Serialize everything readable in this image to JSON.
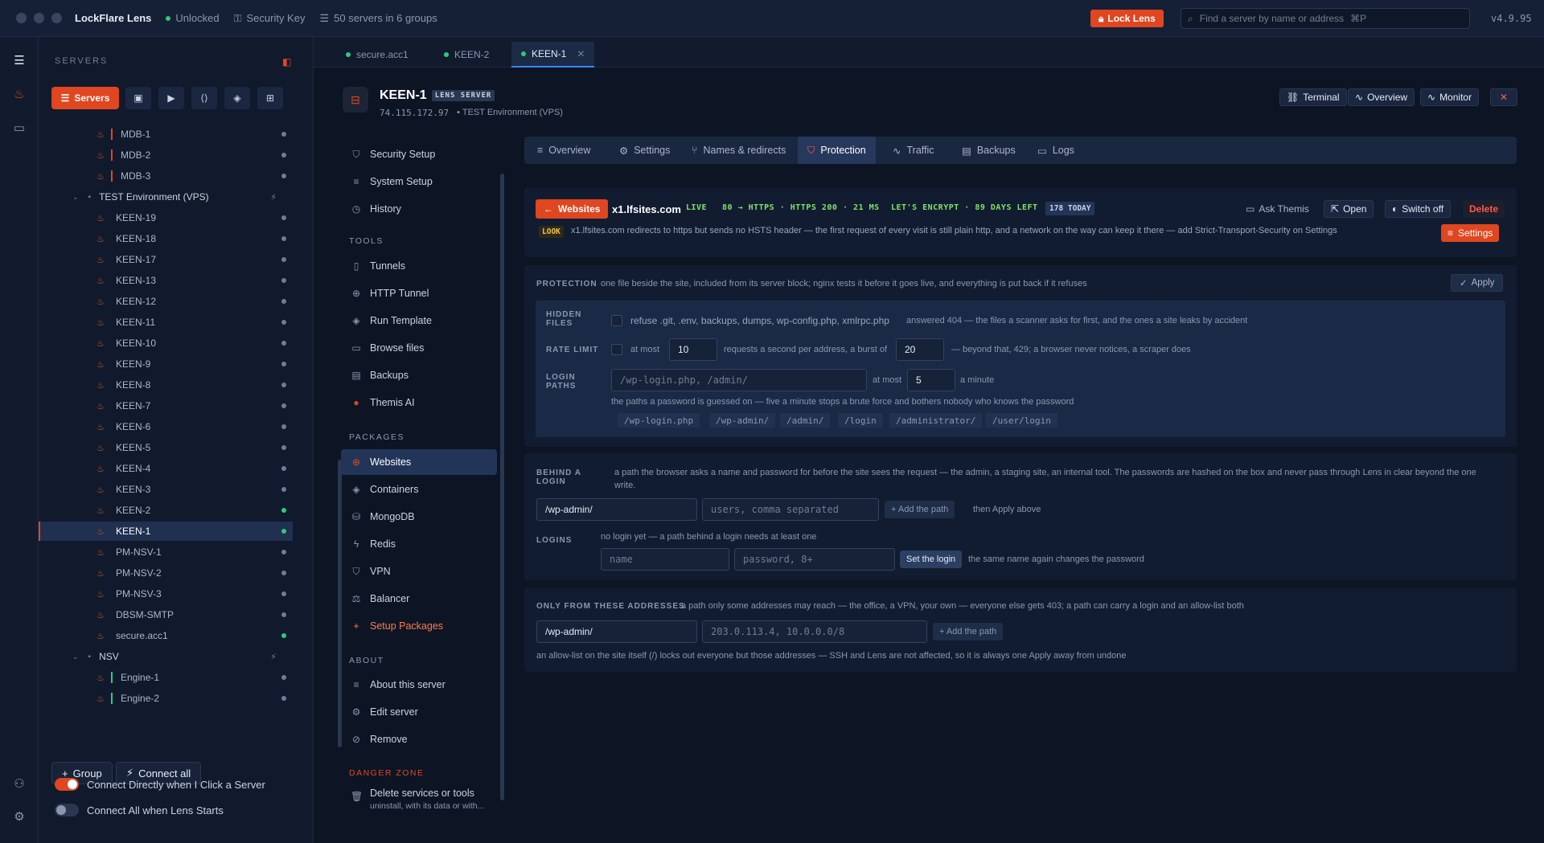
{
  "titlebar": {
    "app_name": "LockFlare Lens",
    "status": "Unlocked",
    "security_key": "Security Key",
    "servers_summary": "50 servers in 6 groups",
    "lock_button": "Lock Lens",
    "search_placeholder": "Find a server by name or address",
    "search_shortcut": "⌘P",
    "version": "v4.9.95"
  },
  "sidebar": {
    "heading": "SERVERS",
    "filter_active": "Servers",
    "tree": [
      {
        "type": "server",
        "name": "MDB-1",
        "status": "idle",
        "bar": "#e0461f"
      },
      {
        "type": "server",
        "name": "MDB-2",
        "status": "idle",
        "bar": "#e0461f"
      },
      {
        "type": "server",
        "name": "MDB-3",
        "status": "idle",
        "bar": "#e0461f"
      },
      {
        "type": "group",
        "name": "TEST Environment (VPS)"
      },
      {
        "type": "server",
        "name": "KEEN-19",
        "status": "idle"
      },
      {
        "type": "server",
        "name": "KEEN-18",
        "status": "idle"
      },
      {
        "type": "server",
        "name": "KEEN-17",
        "status": "idle"
      },
      {
        "type": "server",
        "name": "KEEN-13",
        "status": "idle"
      },
      {
        "type": "server",
        "name": "KEEN-12",
        "status": "idle"
      },
      {
        "type": "server",
        "name": "KEEN-11",
        "status": "idle"
      },
      {
        "type": "server",
        "name": "KEEN-10",
        "status": "idle"
      },
      {
        "type": "server",
        "name": "KEEN-9",
        "status": "idle"
      },
      {
        "type": "server",
        "name": "KEEN-8",
        "status": "idle"
      },
      {
        "type": "server",
        "name": "KEEN-7",
        "status": "idle"
      },
      {
        "type": "server",
        "name": "KEEN-6",
        "status": "idle"
      },
      {
        "type": "server",
        "name": "KEEN-5",
        "status": "idle"
      },
      {
        "type": "server",
        "name": "KEEN-4",
        "status": "idle"
      },
      {
        "type": "server",
        "name": "KEEN-3",
        "status": "idle"
      },
      {
        "type": "server",
        "name": "KEEN-2",
        "status": "online"
      },
      {
        "type": "server",
        "name": "KEEN-1",
        "status": "online",
        "selected": true
      },
      {
        "type": "server",
        "name": "PM-NSV-1",
        "status": "idle"
      },
      {
        "type": "server",
        "name": "PM-NSV-2",
        "status": "idle"
      },
      {
        "type": "server",
        "name": "PM-NSV-3",
        "status": "idle"
      },
      {
        "type": "server",
        "name": "DBSM-SMTP",
        "status": "idle"
      },
      {
        "type": "server",
        "name": "secure.acc1",
        "status": "online"
      },
      {
        "type": "group",
        "name": "NSV"
      },
      {
        "type": "server",
        "name": "Engine-1",
        "status": "idle",
        "bar": "#34c77b"
      },
      {
        "type": "server",
        "name": "Engine-2",
        "status": "idle",
        "bar": "#34c77b"
      }
    ],
    "group_button": "Group",
    "connect_all_button": "Connect all",
    "toggle_connect_directly": "Connect Directly when I Click a Server",
    "toggle_connect_all": "Connect All when Lens Starts",
    "toggle_connect_directly_on": true,
    "toggle_connect_all_on": false
  },
  "tabs": [
    {
      "label": "secure.acc1"
    },
    {
      "label": "KEEN-2"
    },
    {
      "label": "KEEN-1",
      "active": true
    }
  ],
  "server": {
    "name": "KEEN-1",
    "badge": "LENS SERVER",
    "address": "74.115.172.97",
    "group": "TEST Environment (VPS)",
    "btn_terminal": "Terminal",
    "btn_overview": "Overview",
    "btn_monitor": "Monitor"
  },
  "menu": {
    "security_setup": "Security Setup",
    "system_setup": "System Setup",
    "history": "History",
    "tools_heading": "TOOLS",
    "tunnels": "Tunnels",
    "http_tunnel": "HTTP Tunnel",
    "run_template": "Run Template",
    "browse_files": "Browse files",
    "backups": "Backups",
    "themis_ai": "Themis AI",
    "packages_heading": "PACKAGES",
    "websites": "Websites",
    "containers": "Containers",
    "mongodb": "MongoDB",
    "redis": "Redis",
    "vpn": "VPN",
    "balancer": "Balancer",
    "setup_packages": "Setup Packages",
    "about_heading": "ABOUT",
    "about_server": "About this server",
    "edit_server": "Edit server",
    "remove": "Remove",
    "danger_heading": "DANGER ZONE",
    "delete_services": "Delete services or tools",
    "delete_services_sub": "uninstall, with its data or with..."
  },
  "content_tabs": {
    "overview": "Overview",
    "settings": "Settings",
    "names": "Names & redirects",
    "protection": "Protection",
    "traffic": "Traffic",
    "backups": "Backups",
    "logs": "Logs"
  },
  "website": {
    "websites_btn": "Websites",
    "domain": "x1.lfsites.com",
    "live": "LIVE",
    "https": "80 → HTTPS · HTTPS 200 · 21 MS",
    "cert": "LET'S ENCRYPT · 89 DAYS LEFT",
    "today": "178 TODAY",
    "ask_themis": "Ask Themis",
    "open": "Open",
    "switch_off": "Switch off",
    "delete": "Delete",
    "look_badge": "LOOK",
    "look_text": "x1.lfsites.com redirects to https but sends no HSTS header — the first request of every visit is still plain http, and a network on the way can keep it there — add Strict-Transport-Security on Settings",
    "settings_btn": "Settings"
  },
  "protection": {
    "label": "PROTECTION",
    "desc": "one file beside the site, included from its server block; nginx tests it before it goes live, and everything is put back if it refuses",
    "apply": "Apply",
    "hidden_files_label_1": "HIDDEN",
    "hidden_files_label_2": "FILES",
    "hidden_files_text": "refuse .git, .env, backups, dumps, wp-config.php, xmlrpc.php",
    "hidden_files_note": "answered 404 — the files a scanner asks for first, and the ones a site leaks by accident",
    "rate_limit_label": "RATE LIMIT",
    "at_most": "at most",
    "rate_value": "10",
    "rate_text": "requests a second per address, a burst of",
    "burst_value": "20",
    "rate_note": "— beyond that, 429; a browser never notices, a scraper does",
    "login_paths_label_1": "LOGIN",
    "login_paths_label_2": "PATHS",
    "login_paths_placeholder": "/wp-login.php, /admin/",
    "login_at_most": "at most",
    "login_value": "5",
    "login_per": "a minute",
    "login_note": "the paths a password is guessed on — five a minute stops a brute force and bothers nobody who knows the password",
    "chips": [
      "/wp-login.php",
      "/wp-admin/",
      "/admin/",
      "/login",
      "/administrator/",
      "/user/login"
    ]
  },
  "behind_login": {
    "label_1": "BEHIND A",
    "label_2": "LOGIN",
    "desc": "a path the browser asks a name and password for before the site sees the request — the admin, a staging site, an internal tool. The passwords are hashed on the box and never pass through Lens in clear beyond the one write.",
    "path_value": "/wp-admin/",
    "users_placeholder": "users, comma separated",
    "add_path": "+ Add the path",
    "then_apply": "then Apply above",
    "logins_label": "LOGINS",
    "logins_note": "no login yet — a path behind a login needs at least one",
    "name_placeholder": "name",
    "password_placeholder": "password, 8+",
    "set_login": "Set the login",
    "set_login_note": "the same name again changes the password"
  },
  "only_from": {
    "label": "ONLY FROM THESE ADDRESSES",
    "desc": "a path only some addresses may reach — the office, a VPN, your own — everyone else gets 403; a path can carry a login and an allow-list both",
    "path_value": "/wp-admin/",
    "addr_placeholder": "203.0.113.4, 10.0.0.0/8",
    "add_path": "+ Add the path",
    "note": "an allow-list on the site itself (/) locks out everyone but those addresses — SSH and Lens are not affected, so it is always one Apply away from undone"
  }
}
